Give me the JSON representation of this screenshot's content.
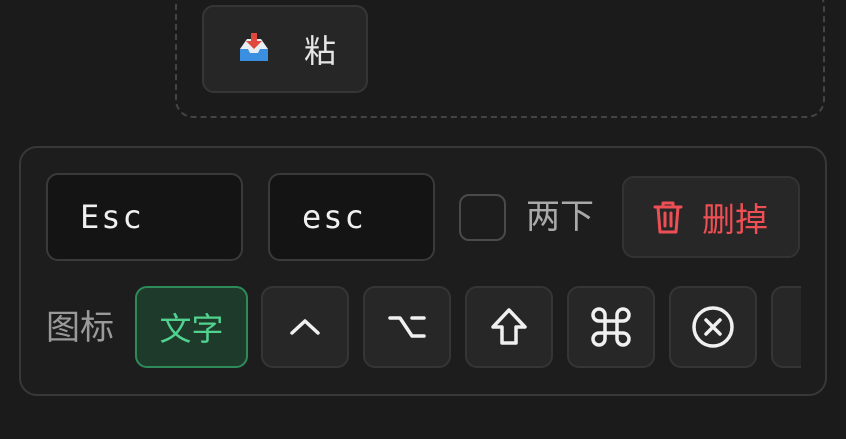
{
  "paste": {
    "label": "粘",
    "icon": "inbox-tray-icon"
  },
  "shortcut": {
    "key_display": "Esc",
    "key_code": "esc",
    "double_tap_label": "两下",
    "double_tap_checked": false,
    "delete_label": "删掉"
  },
  "icon_picker": {
    "label": "图标",
    "text_option": "文字",
    "selected": "text",
    "options": [
      "control-caret-icon",
      "option-key-icon",
      "shift-arrow-icon",
      "command-key-icon",
      "escape-circle-x-icon",
      "more-icon"
    ]
  },
  "colors": {
    "accent_green": "#52d18e",
    "danger_red": "#ee4f55",
    "tray_blue": "#3b8fe0",
    "tray_red": "#e0483e"
  }
}
